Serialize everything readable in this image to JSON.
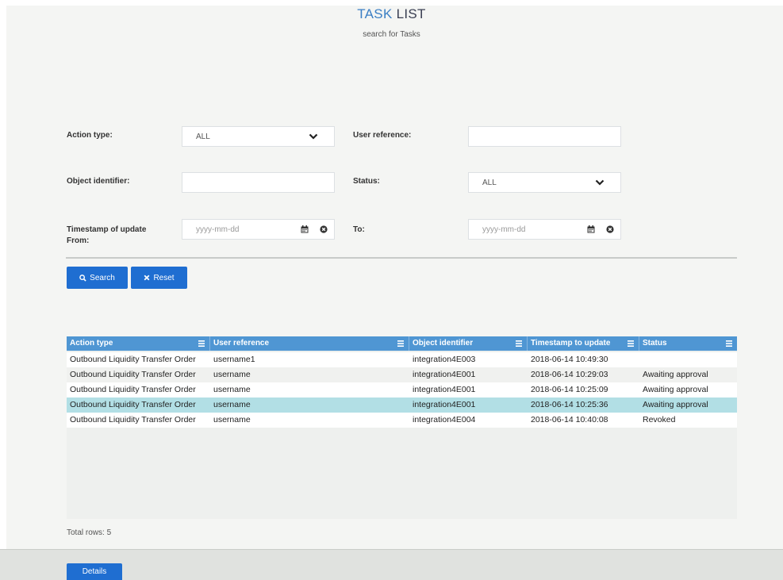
{
  "header": {
    "title_part1": "TASK",
    "title_part2": "LIST",
    "subtitle": "search for Tasks"
  },
  "filters": {
    "action_type": {
      "label": "Action type:",
      "value": "ALL"
    },
    "user_reference": {
      "label": "User reference:",
      "value": ""
    },
    "object_identifier": {
      "label": "Object identifier:",
      "value": ""
    },
    "status": {
      "label": "Status:",
      "value": "ALL"
    },
    "timestamp_from": {
      "label_line1": "Timestamp of update",
      "label_line2": "From:",
      "placeholder": "yyyy-mm-dd"
    },
    "timestamp_to": {
      "label": "To:",
      "placeholder": "yyyy-mm-dd"
    }
  },
  "buttons": {
    "search": "Search",
    "reset": "Reset",
    "details": "Details"
  },
  "table": {
    "columns": [
      "Action type",
      "User reference",
      "Object identifier",
      "Timestamp to update",
      "Status"
    ],
    "rows": [
      [
        "Outbound Liquidity Transfer Order",
        "username1",
        "integration4E003",
        "2018-06-14 10:49:30",
        ""
      ],
      [
        "Outbound Liquidity Transfer Order",
        "username",
        "integration4E001",
        "2018-06-14 10:29:03",
        "Awaiting approval"
      ],
      [
        "Outbound Liquidity Transfer Order",
        "username",
        "integration4E001",
        "2018-06-14 10:25:09",
        "Awaiting approval"
      ],
      [
        "Outbound Liquidity Transfer Order",
        "username",
        "integration4E001",
        "2018-06-14 10:25:36",
        "Awaiting approval"
      ],
      [
        "Outbound Liquidity Transfer Order",
        "username",
        "integration4E004",
        "2018-06-14 10:40:08",
        "Revoked"
      ]
    ],
    "selected_row": 3,
    "total_rows": "Total rows: 5"
  },
  "colors": {
    "accent": "#1f6ed1",
    "header_bg": "#4f96d3",
    "selected_row": "#b2dfe5"
  },
  "icons": [
    "chevron-down-icon",
    "calendar-icon",
    "clear-circle-icon",
    "search-icon",
    "close-icon",
    "column-menu-icon"
  ]
}
